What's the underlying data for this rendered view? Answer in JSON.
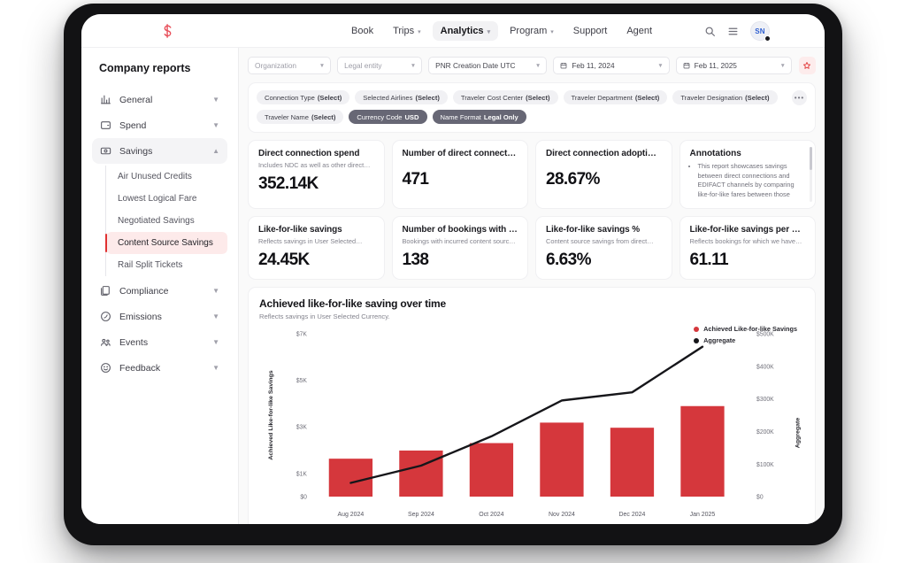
{
  "navbar": {
    "logo": "logo-s-icon",
    "links": [
      {
        "label": "Book",
        "caret": false,
        "active": false
      },
      {
        "label": "Trips",
        "caret": true,
        "active": false
      },
      {
        "label": "Analytics",
        "caret": true,
        "active": true
      },
      {
        "label": "Program",
        "caret": true,
        "active": false
      },
      {
        "label": "Support",
        "caret": false,
        "active": false
      },
      {
        "label": "Agent",
        "caret": false,
        "active": false
      }
    ],
    "search_icon": "search-icon",
    "list_icon": "list-icon",
    "avatar_initials": "SN"
  },
  "sidebar": {
    "title": "Company reports",
    "groups": [
      {
        "label": "General",
        "icon": "chart-icon",
        "expanded": false
      },
      {
        "label": "Spend",
        "icon": "wallet-icon",
        "expanded": false
      },
      {
        "label": "Savings",
        "icon": "savings-icon",
        "expanded": true
      },
      {
        "label": "Compliance",
        "icon": "compliance-icon",
        "expanded": false
      },
      {
        "label": "Emissions",
        "icon": "leaf-icon",
        "expanded": false
      },
      {
        "label": "Events",
        "icon": "events-icon",
        "expanded": false
      },
      {
        "label": "Feedback",
        "icon": "smiley-icon",
        "expanded": false
      }
    ],
    "savings_subitems": [
      {
        "label": "Air Unused Credits",
        "active": false
      },
      {
        "label": "Lowest Logical Fare",
        "active": false
      },
      {
        "label": "Negotiated Savings",
        "active": false
      },
      {
        "label": "Content Source Savings",
        "active": true
      },
      {
        "label": "Rail Split Tickets",
        "active": false
      }
    ]
  },
  "filters": {
    "organization": {
      "value": "Organization",
      "placeholder": "Organization"
    },
    "legal_entity": {
      "value": "Legal entity",
      "placeholder": "Legal entity"
    },
    "date_type": {
      "value": "PNR Creation Date UTC"
    },
    "date_from": {
      "value": "Feb 11, 2024"
    },
    "date_to": {
      "value": "Feb 11, 2025"
    },
    "favorite_icon": "star-icon"
  },
  "chips": {
    "more_label": "•••",
    "items": [
      {
        "label": "Connection Type",
        "value": "(Select)",
        "dark": false
      },
      {
        "label": "Selected Airlines",
        "value": "(Select)",
        "dark": false
      },
      {
        "label": "Traveler Cost Center",
        "value": "(Select)",
        "dark": false
      },
      {
        "label": "Traveler Department",
        "value": "(Select)",
        "dark": false
      },
      {
        "label": "Traveler Designation",
        "value": "(Select)",
        "dark": false
      },
      {
        "label": "Traveler Name",
        "value": "(Select)",
        "dark": false
      },
      {
        "label": "Currency Code",
        "value": "USD",
        "dark": true
      },
      {
        "label": "Name Format",
        "value": "Legal Only",
        "dark": true
      }
    ]
  },
  "kpis_row1": [
    {
      "title": "Direct connection spend",
      "subtitle": "Includes NDC as well as other direct…",
      "value": "352.14K"
    },
    {
      "title": "Number of direct connectio…",
      "subtitle": "",
      "value": "471"
    },
    {
      "title": "Direct connection adoption %",
      "subtitle": "",
      "value": "28.67%"
    }
  ],
  "annotations": {
    "title": "Annotations",
    "items": [
      "This report showcases savings between direct connections and EDIFACT channels by comparing like-for-like fares between those"
    ]
  },
  "kpis_row2": [
    {
      "title": "Like-for-like savings",
      "subtitle": "Reflects savings in User Selected…",
      "value": "24.45K"
    },
    {
      "title": "Number of bookings with lik…",
      "subtitle": "Bookings with incurred content sourc…",
      "value": "138"
    },
    {
      "title": "Like-for-like savings %",
      "subtitle": "Content source savings from direct…",
      "value": "6.63%"
    },
    {
      "title": "Like-for-like savings per boo…",
      "subtitle": "Reflects bookings for which we have…",
      "value": "61.11"
    }
  ],
  "chart_data": {
    "type": "bar",
    "title": "Achieved like-for-like saving over time",
    "subtitle": "Reflects savings in User Selected Currency.",
    "categories": [
      "Aug 2024",
      "Sep 2024",
      "Oct 2024",
      "Nov 2024",
      "Dec 2024",
      "Jan 2025"
    ],
    "series": [
      {
        "name": "Achieved Like-for-like Savings",
        "type": "bar",
        "axis": "left",
        "color": "#d5373c",
        "values": [
          1630,
          1980,
          2300,
          3180,
          2960,
          3890
        ]
      },
      {
        "name": "Aggregate",
        "type": "line",
        "axis": "right",
        "color": "#16161a",
        "values": [
          42000,
          95000,
          185000,
          295000,
          320000,
          460000
        ]
      }
    ],
    "ylabel": "Achieved Like-for-like Savings",
    "ylabel_right": "Aggregate",
    "xlabel": "",
    "ylim": [
      0,
      7000
    ],
    "ylim_right": [
      0,
      500000
    ],
    "yticks": [
      "$0",
      "$1K",
      "$3K",
      "$5K",
      "$7K"
    ],
    "ytick_values": [
      0,
      1000,
      3000,
      5000,
      7000
    ],
    "yticks_right": [
      "$0",
      "$100K",
      "$200K",
      "$300K",
      "$400K",
      "$500K"
    ],
    "ytick_right_values": [
      0,
      100000,
      200000,
      300000,
      400000,
      500000
    ],
    "grid": false,
    "legend_position": "top-right",
    "legend": [
      "Achieved Like-for-like Savings",
      "Aggregate"
    ]
  }
}
